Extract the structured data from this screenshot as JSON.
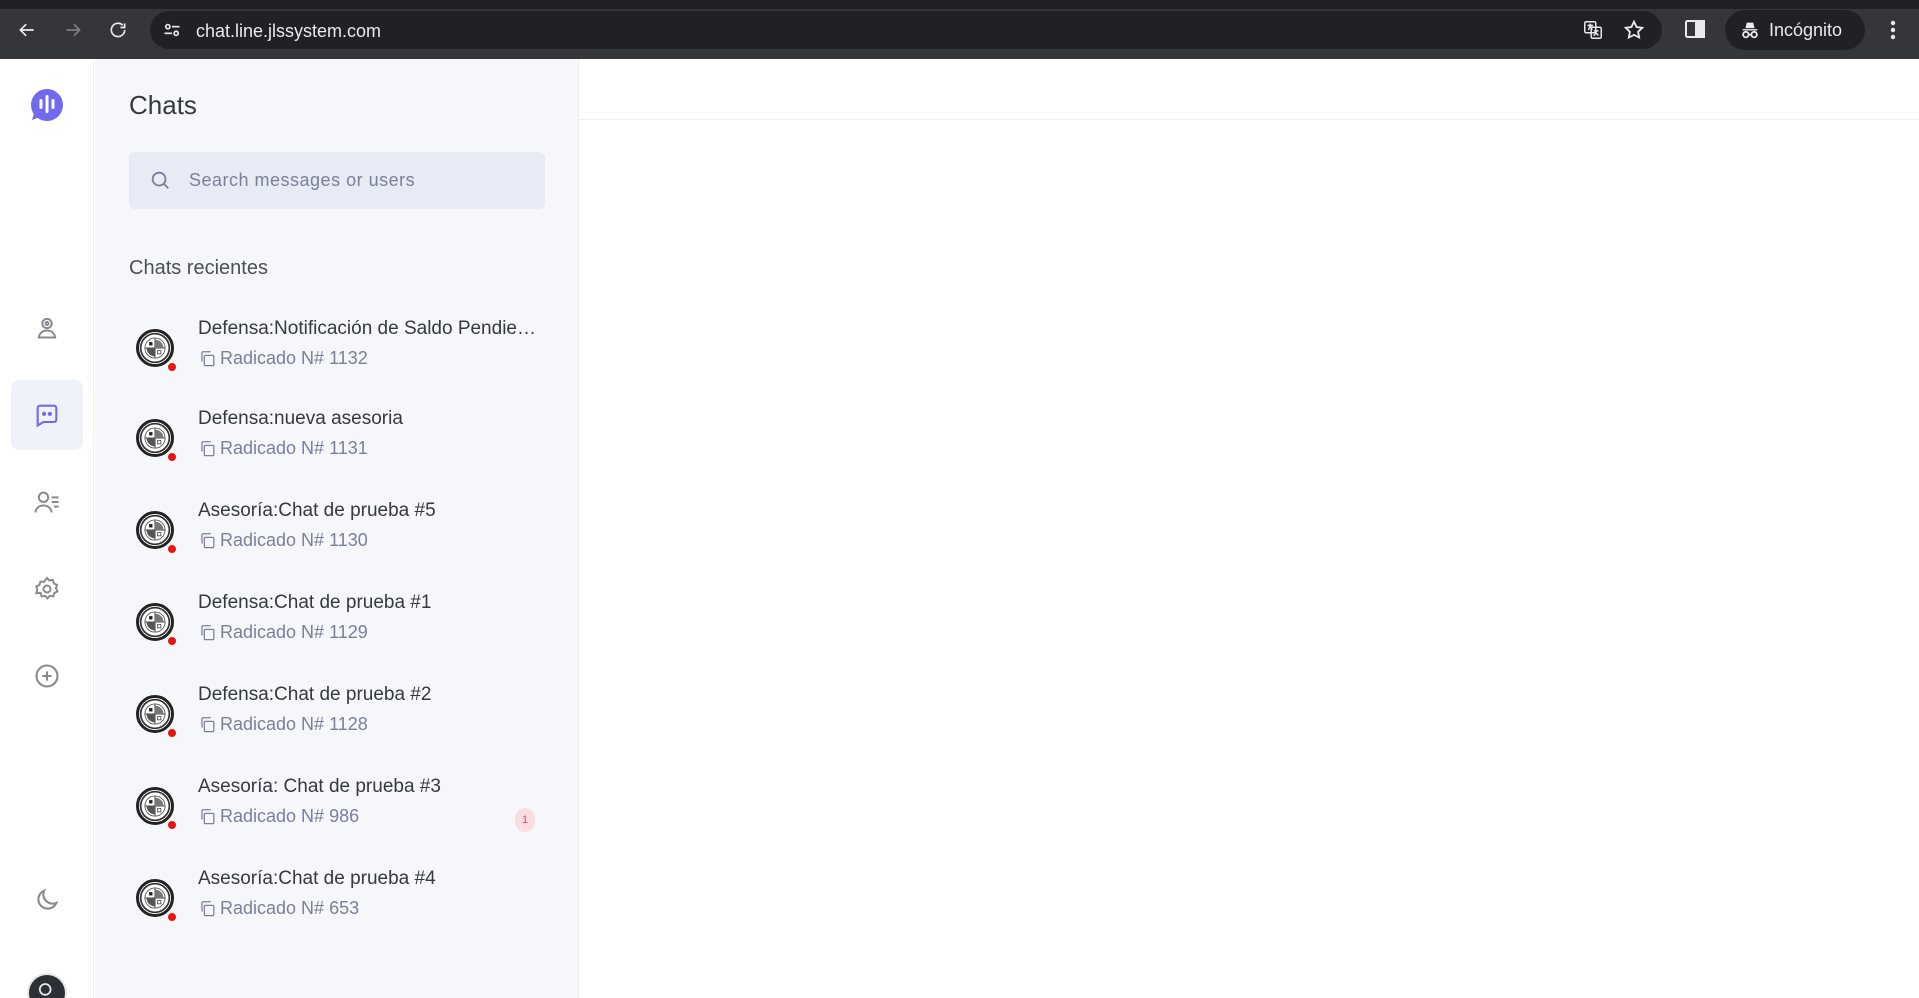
{
  "browser": {
    "url": "chat.line.jlssystem.com",
    "incognito_label": "Incógnito"
  },
  "colors": {
    "accent": "#7269ef",
    "sidebar_bg": "#f5f7fb",
    "status_dot": "#e8150c",
    "badge_bg": "#fbdde2"
  },
  "rail": {
    "items": [
      {
        "icon": "profile-icon"
      },
      {
        "icon": "chat-icon",
        "active": true
      },
      {
        "icon": "contacts-icon"
      },
      {
        "icon": "settings-icon"
      },
      {
        "icon": "add-circle-icon"
      },
      {
        "icon": "dark-mode-icon"
      }
    ]
  },
  "sidebar": {
    "title": "Chats",
    "search_placeholder": "Search messages or users",
    "recent_heading": "Chats recientes"
  },
  "chats": [
    {
      "name": "Defensa:Notificación de Saldo Pendiente",
      "subtitle": "Radicado N# 1132",
      "unread": ""
    },
    {
      "name": "Defensa:nueva asesoria",
      "subtitle": "Radicado N# 1131",
      "unread": ""
    },
    {
      "name": "Asesoría:Chat de prueba #5",
      "subtitle": "Radicado N# 1130",
      "unread": ""
    },
    {
      "name": "Defensa:Chat de prueba #1",
      "subtitle": "Radicado N# 1129",
      "unread": ""
    },
    {
      "name": "Defensa:Chat de prueba #2",
      "subtitle": "Radicado N# 1128",
      "unread": ""
    },
    {
      "name": "Asesoría: Chat de prueba #3",
      "subtitle": "Radicado N# 986",
      "unread": "1"
    },
    {
      "name": "Asesoría:Chat de prueba #4",
      "subtitle": "Radicado N# 653",
      "unread": ""
    }
  ]
}
